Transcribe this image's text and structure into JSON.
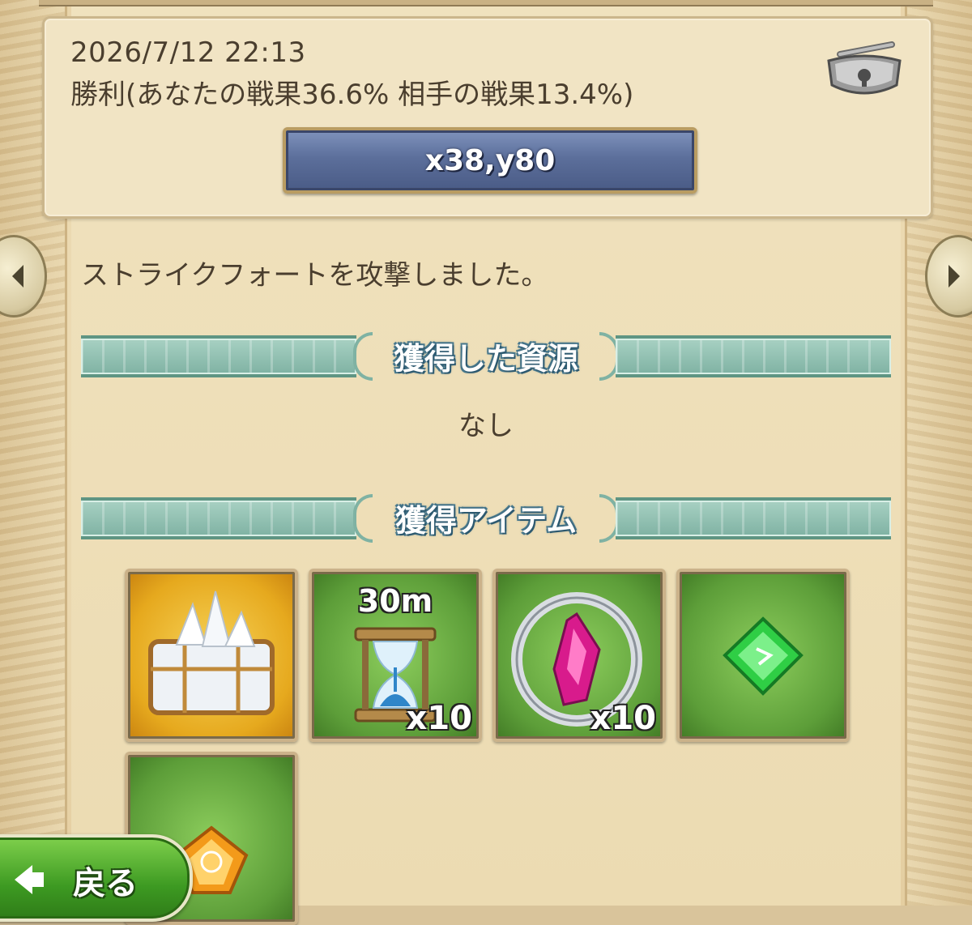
{
  "report": {
    "timestamp": "2026/7/12 22:13",
    "result": "勝利(あなたの戦果36.6% 相手の戦果13.4%)",
    "coordinate_button": "x38,y80"
  },
  "message": "ストライクフォートを攻撃しました。",
  "sections": {
    "resources": {
      "title": "獲得した資源",
      "value": "なし"
    },
    "items": {
      "title": "獲得アイテム"
    }
  },
  "items": [
    {
      "name": "crystal-chest",
      "top_label": "",
      "count": "",
      "bg": "gold"
    },
    {
      "name": "hourglass",
      "top_label": "30m",
      "count": "x10",
      "bg": "green"
    },
    {
      "name": "pink-gem-ring",
      "top_label": "",
      "count": "x10",
      "bg": "green"
    },
    {
      "name": "green-gem",
      "top_label": "",
      "count": "",
      "bg": "green"
    },
    {
      "name": "orange-gem",
      "top_label": "",
      "count": "",
      "bg": "green"
    }
  ],
  "back_button": {
    "label": "戻る"
  },
  "icons": {
    "lock": "padlock-icon",
    "nav_prev": "chevron-left-icon",
    "nav_next": "chevron-right-icon",
    "back": "arrow-left-icon"
  },
  "colors": {
    "parchment": "#f0e2be",
    "button_blue": "#5c6f9b",
    "banner_teal": "#7fb2a3",
    "back_green": "#3d9a22"
  }
}
